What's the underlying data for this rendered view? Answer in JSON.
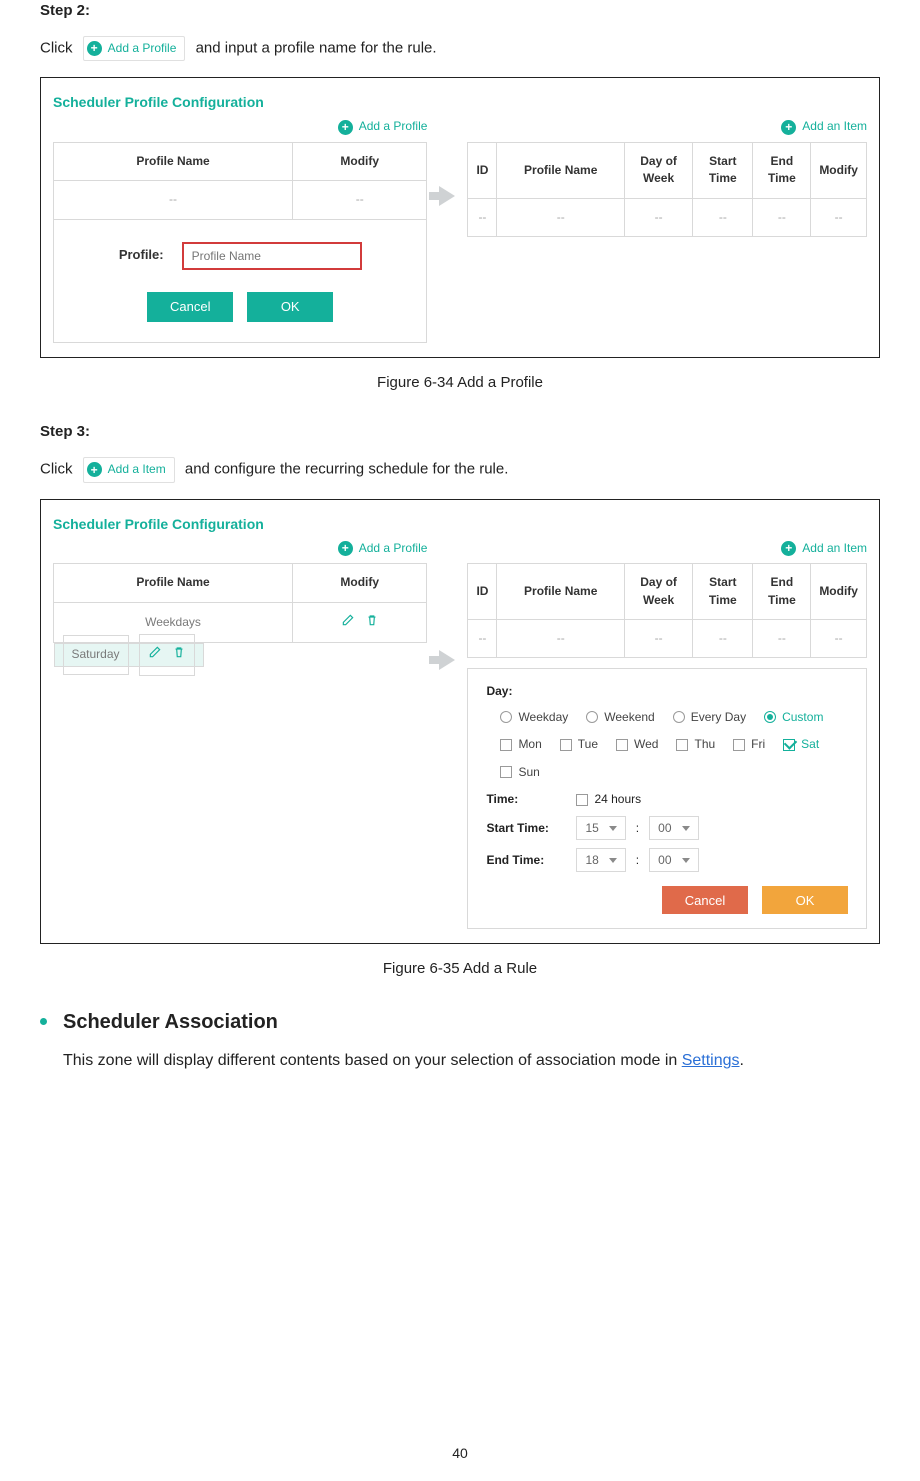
{
  "step2": {
    "heading": "Step 2:",
    "lead_before": "Click",
    "badge": "Add a Profile",
    "lead_after": "and input a profile name for the rule."
  },
  "fig1": {
    "panel_title": "Scheduler Profile Configuration",
    "add_profile": "Add a Profile",
    "add_item": "Add an Item",
    "left_headers": {
      "c1": "Profile Name",
      "c2": "Modify"
    },
    "left_row": {
      "c1": "--",
      "c2": "--"
    },
    "popup": {
      "label": "Profile:",
      "placeholder": "Profile Name",
      "cancel": "Cancel",
      "ok": "OK"
    },
    "right_headers": {
      "c1": "ID",
      "c2": "Profile Name",
      "c3": "Day of Week",
      "c4": "Start Time",
      "c5": "End Time",
      "c6": "Modify"
    },
    "right_row": {
      "c1": "--",
      "c2": "--",
      "c3": "--",
      "c4": "--",
      "c5": "--",
      "c6": "--"
    },
    "caption": "Figure 6-34 Add a Profile"
  },
  "step3": {
    "heading": "Step 3:",
    "lead_before": "Click",
    "badge": "Add a Item",
    "lead_after": "and configure the recurring schedule for the rule."
  },
  "fig2": {
    "panel_title": "Scheduler Profile Configuration",
    "add_profile": "Add a Profile",
    "add_item": "Add an Item",
    "left_headers": {
      "c1": "Profile Name",
      "c2": "Modify"
    },
    "left_rows": [
      {
        "name": "Weekdays"
      },
      {
        "name": "Saturday"
      }
    ],
    "right_headers": {
      "c1": "ID",
      "c2": "Profile Name",
      "c3": "Day of Week",
      "c4": "Start Time",
      "c5": "End Time",
      "c6": "Modify"
    },
    "right_row": {
      "c1": "--",
      "c2": "--",
      "c3": "--",
      "c4": "--",
      "c5": "--",
      "c6": "--"
    },
    "popup2": {
      "day_label": "Day:",
      "radios": {
        "weekday": "Weekday",
        "weekend": "Weekend",
        "everyday": "Every Day",
        "custom": "Custom"
      },
      "days": {
        "mon": "Mon",
        "tue": "Tue",
        "wed": "Wed",
        "thu": "Thu",
        "fri": "Fri",
        "sat": "Sat",
        "sun": "Sun"
      },
      "time_label": "Time:",
      "twentyfour": "24 hours",
      "start_label": "Start Time:",
      "end_label": "End Time:",
      "start_h": "15",
      "start_m": "00",
      "end_h": "18",
      "end_m": "00",
      "colon": ":",
      "cancel": "Cancel",
      "ok": "OK"
    },
    "caption": "Figure 6-35 Add a Rule"
  },
  "assoc": {
    "heading": "Scheduler Association",
    "text_before": "This zone will display different contents based on your selection of association mode in ",
    "link": "Settings",
    "text_after": "."
  },
  "page_number": "40"
}
